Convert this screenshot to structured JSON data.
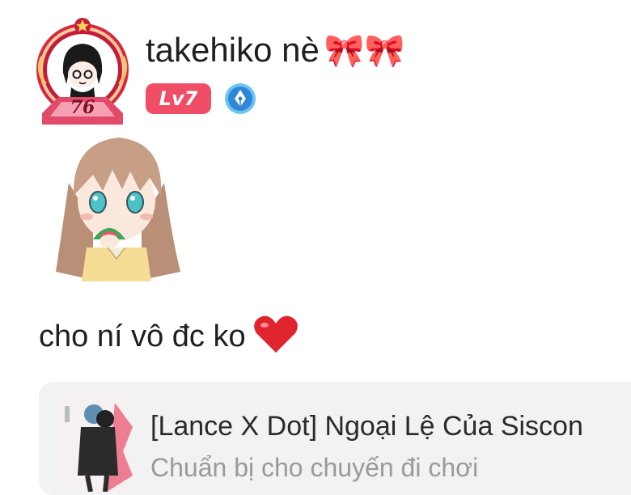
{
  "profile": {
    "username": "takehiko nè",
    "emoji": "🎀🎀",
    "level_label": "Lv7",
    "avatar_number": "76",
    "verify_icon": "pen-nib-icon",
    "level_color": "#f04d66"
  },
  "message": {
    "text": "cho ní vô đc ko",
    "emoji": "heart-icon"
  },
  "link_card": {
    "title": "[Lance X Dot] Ngoại Lệ Của Siscon",
    "subtitle": "Chuẩn bị cho chuyến đi chơi"
  }
}
